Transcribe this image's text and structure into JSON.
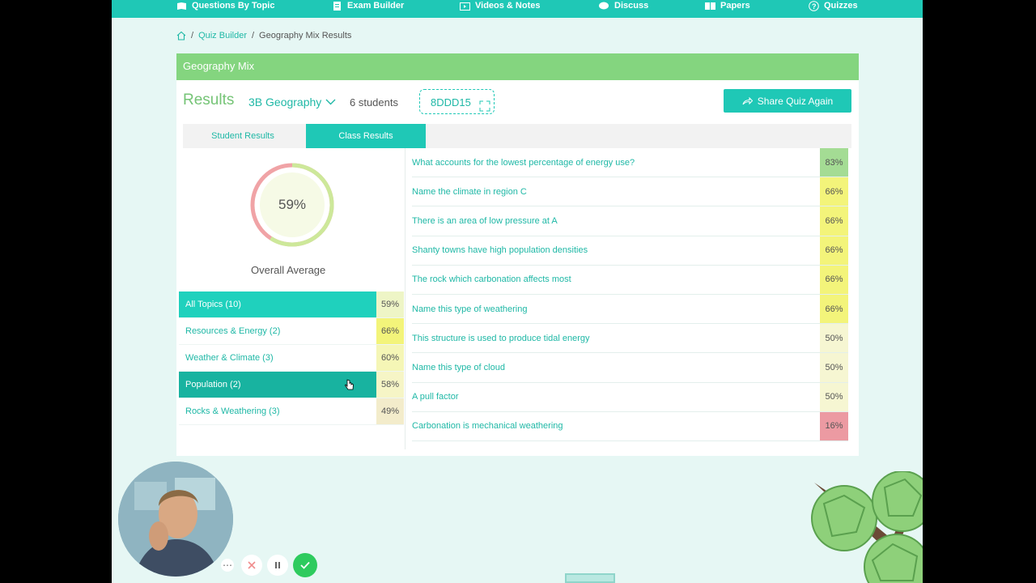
{
  "nav": [
    {
      "label": "Questions By Topic",
      "icon": "book-icon"
    },
    {
      "label": "Exam Builder",
      "icon": "document-icon"
    },
    {
      "label": "Videos & Notes",
      "icon": "video-icon"
    },
    {
      "label": "Discuss",
      "icon": "chat-icon"
    },
    {
      "label": "Papers",
      "icon": "papers-icon"
    },
    {
      "label": "Quizzes",
      "icon": "question-icon"
    }
  ],
  "breadcrumb": {
    "separator": "/",
    "parent": "Quiz Builder",
    "current": "Geography Mix Results"
  },
  "quiz": {
    "title": "Geography Mix",
    "results_label": "Results",
    "class_name": "3B Geography",
    "students": "6 students",
    "code": "8DDD15",
    "share_label": "Share Quiz Again"
  },
  "tabs": [
    {
      "label": "Student Results",
      "active": false
    },
    {
      "label": "Class Results",
      "active": true
    }
  ],
  "overall": {
    "value": "59%",
    "fraction": 0.59,
    "label": "Overall Average"
  },
  "topics": [
    {
      "name": "All Topics (10)",
      "pct": "59%",
      "state": "active",
      "color": "#eef5c6"
    },
    {
      "name": "Resources & Energy (2)",
      "pct": "66%",
      "state": "",
      "color": "#f3f47a"
    },
    {
      "name": "Weather & Climate (3)",
      "pct": "60%",
      "state": "",
      "color": "#f5f6b6"
    },
    {
      "name": "Population (2)",
      "pct": "58%",
      "state": "selected",
      "color": "#f6f5c6"
    },
    {
      "name": "Rocks & Weathering (3)",
      "pct": "49%",
      "state": "",
      "color": "#f3eccb"
    }
  ],
  "questions": [
    {
      "text": "What accounts for the lowest percentage of energy use?",
      "pct": "83%",
      "color": "#a4dc94"
    },
    {
      "text": "Name the climate in region C",
      "pct": "66%",
      "color": "#f3f47a"
    },
    {
      "text": "There is an area of low pressure at A",
      "pct": "66%",
      "color": "#f3f47a"
    },
    {
      "text": "Shanty towns have high population densities",
      "pct": "66%",
      "color": "#f3f47a"
    },
    {
      "text": "The rock which carbonation affects most",
      "pct": "66%",
      "color": "#f3f47a"
    },
    {
      "text": "Name this type of weathering",
      "pct": "66%",
      "color": "#f3f47a"
    },
    {
      "text": "This structure is used to produce tidal energy",
      "pct": "50%",
      "color": "#f6f6d2"
    },
    {
      "text": "Name this type of cloud",
      "pct": "50%",
      "color": "#f6f6d2"
    },
    {
      "text": "A pull factor",
      "pct": "50%",
      "color": "#f6f6d2"
    },
    {
      "text": "Carbonation is mechanical weathering",
      "pct": "16%",
      "color": "#ec9aa2"
    }
  ],
  "colors": {
    "accent": "#1fc8b6",
    "header_green": "#84d57f",
    "donut_good": "#cde89a",
    "donut_bad": "#f0a3a6"
  }
}
